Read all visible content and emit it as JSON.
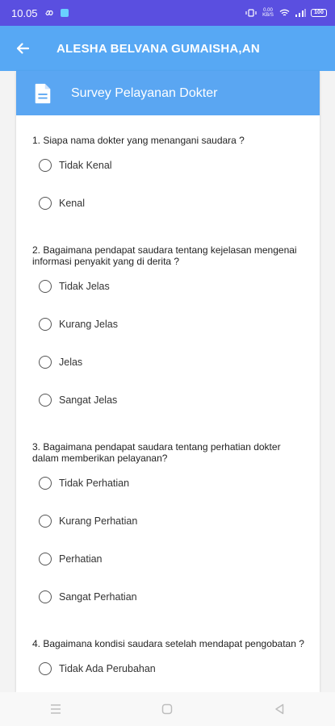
{
  "status_bar": {
    "time": "10.05",
    "network_speed": "0.00 KB/S",
    "battery_level": "100"
  },
  "app_bar": {
    "title": "ALESHA BELVANA GUMAISHA,AN",
    "back_icon": "arrow-left-icon"
  },
  "survey": {
    "title": "Survey Pelayanan Dokter",
    "header_icon": "document-icon",
    "questions": [
      {
        "text": "1. Siapa nama dokter yang menangani saudara ?",
        "options": [
          "Tidak Kenal",
          "Kenal"
        ]
      },
      {
        "text": "2. Bagaimana pendapat saudara tentang kejelasan mengenai informasi penyakit yang di derita ?",
        "options": [
          "Tidak Jelas",
          "Kurang Jelas",
          "Jelas",
          "Sangat Jelas"
        ]
      },
      {
        "text": "3. Bagaimana pendapat saudara tentang perhatian dokter dalam memberikan pelayanan?",
        "options": [
          "Tidak Perhatian",
          "Kurang Perhatian",
          "Perhatian",
          "Sangat Perhatian"
        ]
      },
      {
        "text": "4. Bagaimana kondisi saudara setelah mendapat pengobatan ?",
        "options": [
          "Tidak Ada Perubahan"
        ]
      }
    ]
  },
  "colors": {
    "status_bar": "#5a4fe0",
    "app_bar": "#57a8f4",
    "card_header": "#5aa6f2"
  }
}
